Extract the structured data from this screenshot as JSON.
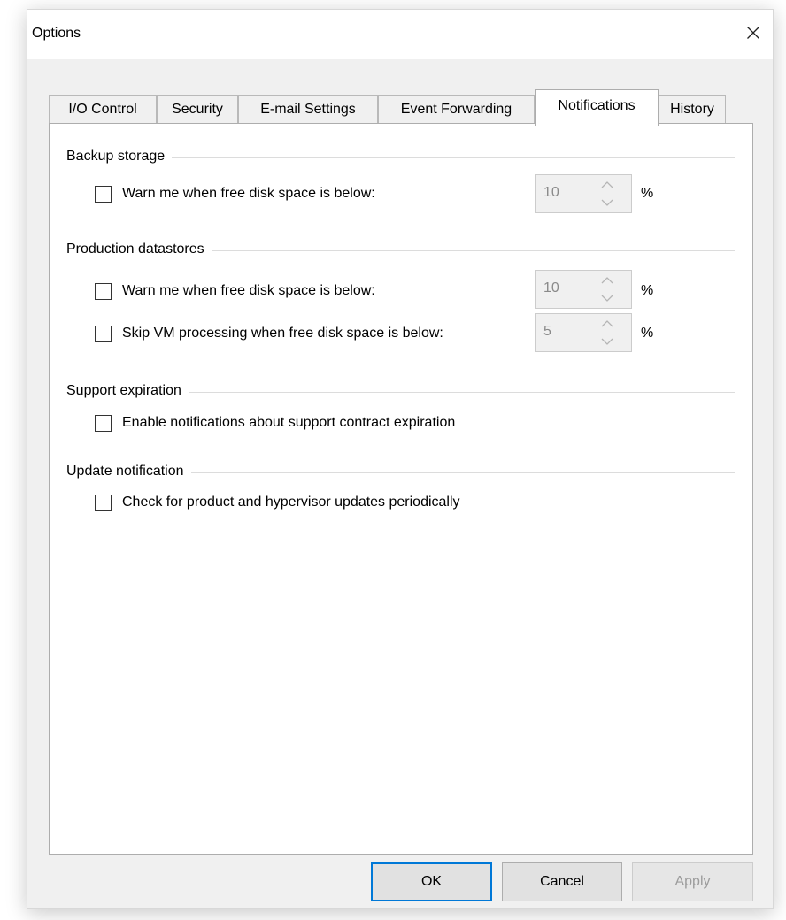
{
  "window": {
    "title": "Options"
  },
  "tabs": [
    {
      "label": "I/O Control"
    },
    {
      "label": "Security"
    },
    {
      "label": "E-mail Settings"
    },
    {
      "label": "Event Forwarding"
    },
    {
      "label": "Notifications",
      "selected": true
    },
    {
      "label": "History"
    }
  ],
  "groups": {
    "backup_storage": {
      "title": "Backup storage",
      "warn": {
        "label": "Warn me when free disk space is below:",
        "checked": false,
        "value": "10",
        "unit": "%"
      }
    },
    "production_datastores": {
      "title": "Production datastores",
      "warn": {
        "label": "Warn me when free disk space is below:",
        "checked": false,
        "value": "10",
        "unit": "%"
      },
      "skip": {
        "label": "Skip VM processing when free disk space is below:",
        "checked": false,
        "value": "5",
        "unit": "%"
      }
    },
    "support_expiration": {
      "title": "Support expiration",
      "enable": {
        "label": "Enable notifications about support contract expiration",
        "checked": false
      }
    },
    "update_notification": {
      "title": "Update notification",
      "check": {
        "label": "Check for product and hypervisor updates periodically",
        "checked": false
      }
    }
  },
  "buttons": {
    "ok": "OK",
    "cancel": "Cancel",
    "apply": "Apply"
  },
  "colors": {
    "accent": "#0078d7",
    "dialog_bg": "#f0f0f0",
    "panel_bg": "#ffffff",
    "disabled_text": "#8a8a8a"
  },
  "icons": {
    "close": "close-icon",
    "spin_up": "chevron-up-icon",
    "spin_down": "chevron-down-icon"
  }
}
